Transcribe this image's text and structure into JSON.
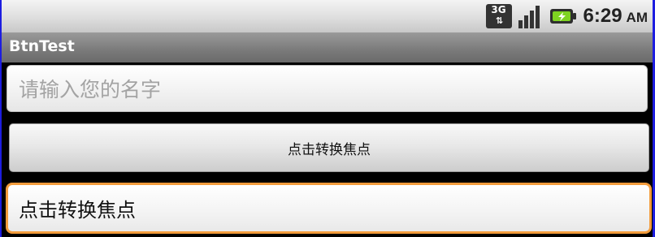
{
  "status_bar": {
    "network_icon": "3g-data-icon",
    "network_label": "3G",
    "signal_icon": "signal-strength-icon",
    "battery_icon": "battery-charging-icon",
    "time": "6:29",
    "ampm": "AM"
  },
  "app": {
    "title": "BtnTest"
  },
  "form": {
    "name_input_placeholder": "请输入您的名字",
    "button_label": "点击转换焦点",
    "focused_field_value": "点击转换焦点"
  },
  "colors": {
    "focus_border": "#f39c3c",
    "title_bar": "#7a7a7a",
    "window_border": "#1d1de0"
  }
}
